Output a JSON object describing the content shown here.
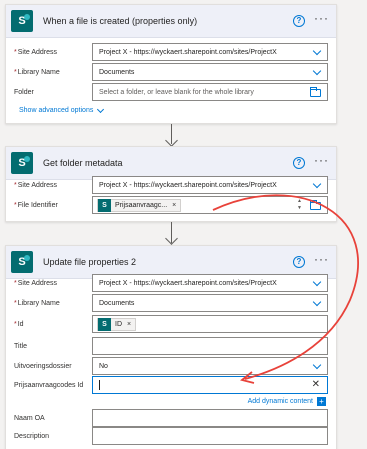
{
  "cards": [
    {
      "title": "When a file is created (properties only)",
      "fields": {
        "site_address": {
          "label": "Site Address",
          "value": "Project X - https://wyckaert.sharepoint.com/sites/ProjectX"
        },
        "library_name": {
          "label": "Library Name",
          "value": "Documents"
        },
        "folder": {
          "label": "Folder",
          "placeholder": "Select a folder, or leave blank for the whole library"
        }
      },
      "advanced_link": "Show advanced options"
    },
    {
      "title": "Get folder metadata",
      "fields": {
        "site_address": {
          "label": "Site Address",
          "value": "Project X - https://wyckaert.sharepoint.com/sites/ProjectX"
        },
        "file_identifier": {
          "label": "File Identifier",
          "token": "Prijsaanvraagc..."
        }
      }
    },
    {
      "title": "Update file properties 2",
      "fields": {
        "site_address": {
          "label": "Site Address",
          "value": "Project X - https://wyckaert.sharepoint.com/sites/ProjectX"
        },
        "library_name": {
          "label": "Library Name",
          "value": "Documents"
        },
        "id": {
          "label": "Id",
          "token": "ID"
        },
        "title": {
          "label": "Title"
        },
        "uitvoeringsdossier": {
          "label": "Uitvoeringsdossier",
          "value": "No"
        },
        "prijsaanvraagcodes_id": {
          "label": "Prijsaanvraagcodes Id"
        },
        "naam_oa": {
          "label": "Naam OA"
        },
        "description": {
          "label": "Description"
        }
      },
      "dynamic_link": "Add dynamic content"
    }
  ],
  "icons": {
    "connector": "sharepoint-icon",
    "help": "help-icon",
    "more": "more-options-icon",
    "dropdown": "chevron-down-icon",
    "folder_picker": "folder-icon",
    "clear": "clear-icon",
    "flow_arrow": "arrow-down-icon",
    "annotation": "red-curved-arrow"
  },
  "colors": {
    "accent": "#0078d4",
    "sharepoint": "#036c70",
    "annotation": "#e8423a",
    "required": "#a4262c"
  }
}
